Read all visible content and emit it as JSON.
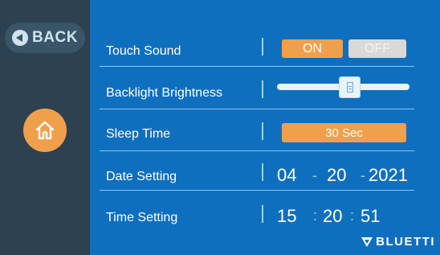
{
  "sidebar": {
    "back_label": "BACK"
  },
  "settings": {
    "touch_sound": {
      "label": "Touch Sound",
      "on_label": "ON",
      "off_label": "OFF",
      "selected": "ON"
    },
    "backlight": {
      "label": "Backlight Brightness",
      "level_fraction": 0.55
    },
    "sleep_time": {
      "label": "Sleep Time",
      "value": "30 Sec"
    },
    "date": {
      "label": "Date Setting",
      "month": "04",
      "day": "20",
      "year": "2021",
      "separator": "-"
    },
    "time": {
      "label": "Time Setting",
      "hour": "15",
      "minute": "20",
      "second": "51",
      "separator": ":"
    }
  },
  "brand": {
    "name": "BLUETTI"
  },
  "colors": {
    "background": "#0f6fbf",
    "sidebar": "#2d4150",
    "accent": "#f0a04b",
    "inactive": "#d9d9d9"
  }
}
